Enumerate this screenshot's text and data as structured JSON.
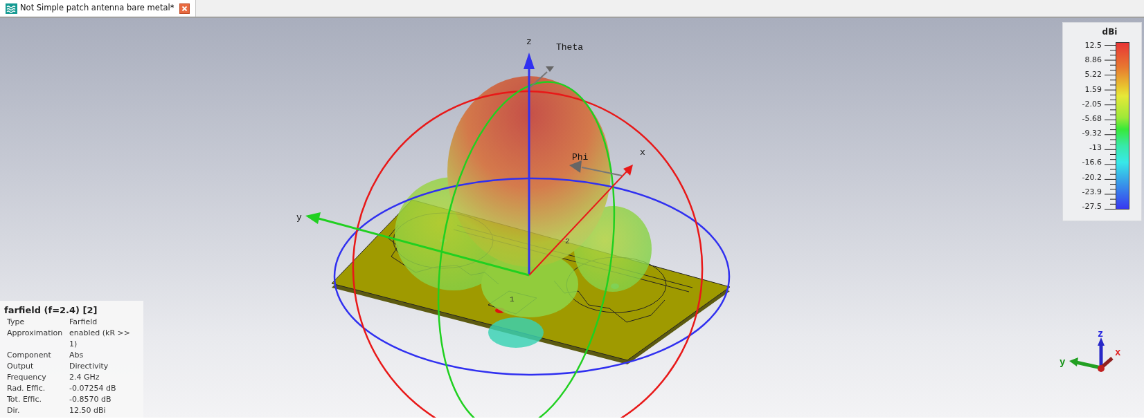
{
  "tab": {
    "title": "Not Simple patch antenna bare metal*",
    "selected": true
  },
  "scene": {
    "axis_labels": {
      "z": "z",
      "x": "x",
      "y": "y"
    },
    "angle_labels": {
      "theta": "Theta",
      "phi": "Phi"
    },
    "ports": [
      "1",
      "2"
    ]
  },
  "colorbar": {
    "unit": "dBi",
    "ticks": [
      "12.5",
      "8.86",
      "5.22",
      "1.59",
      "-2.05",
      "-5.68",
      "-9.32",
      "-13",
      "-16.6",
      "-20.2",
      "-23.9",
      "-27.5"
    ]
  },
  "info_panel": {
    "title": "farfield (f=2.4) [2]",
    "rows": [
      {
        "label": "Type",
        "value": "Farfield"
      },
      {
        "label": "Approximation",
        "value": "enabled (kR >> 1)"
      },
      {
        "label": "Component",
        "value": "Abs"
      },
      {
        "label": "Output",
        "value": "Directivity"
      },
      {
        "label": "Frequency",
        "value": "2.4 GHz"
      },
      {
        "label": "Rad. Effic.",
        "value": "-0.07254 dB"
      },
      {
        "label": "Tot. Effic.",
        "value": "-0.8570 dB"
      },
      {
        "label": "Dir.",
        "value": "12.50 dBi"
      }
    ]
  },
  "orientation_triad": {
    "z": "z",
    "y": "y",
    "x": "x"
  }
}
